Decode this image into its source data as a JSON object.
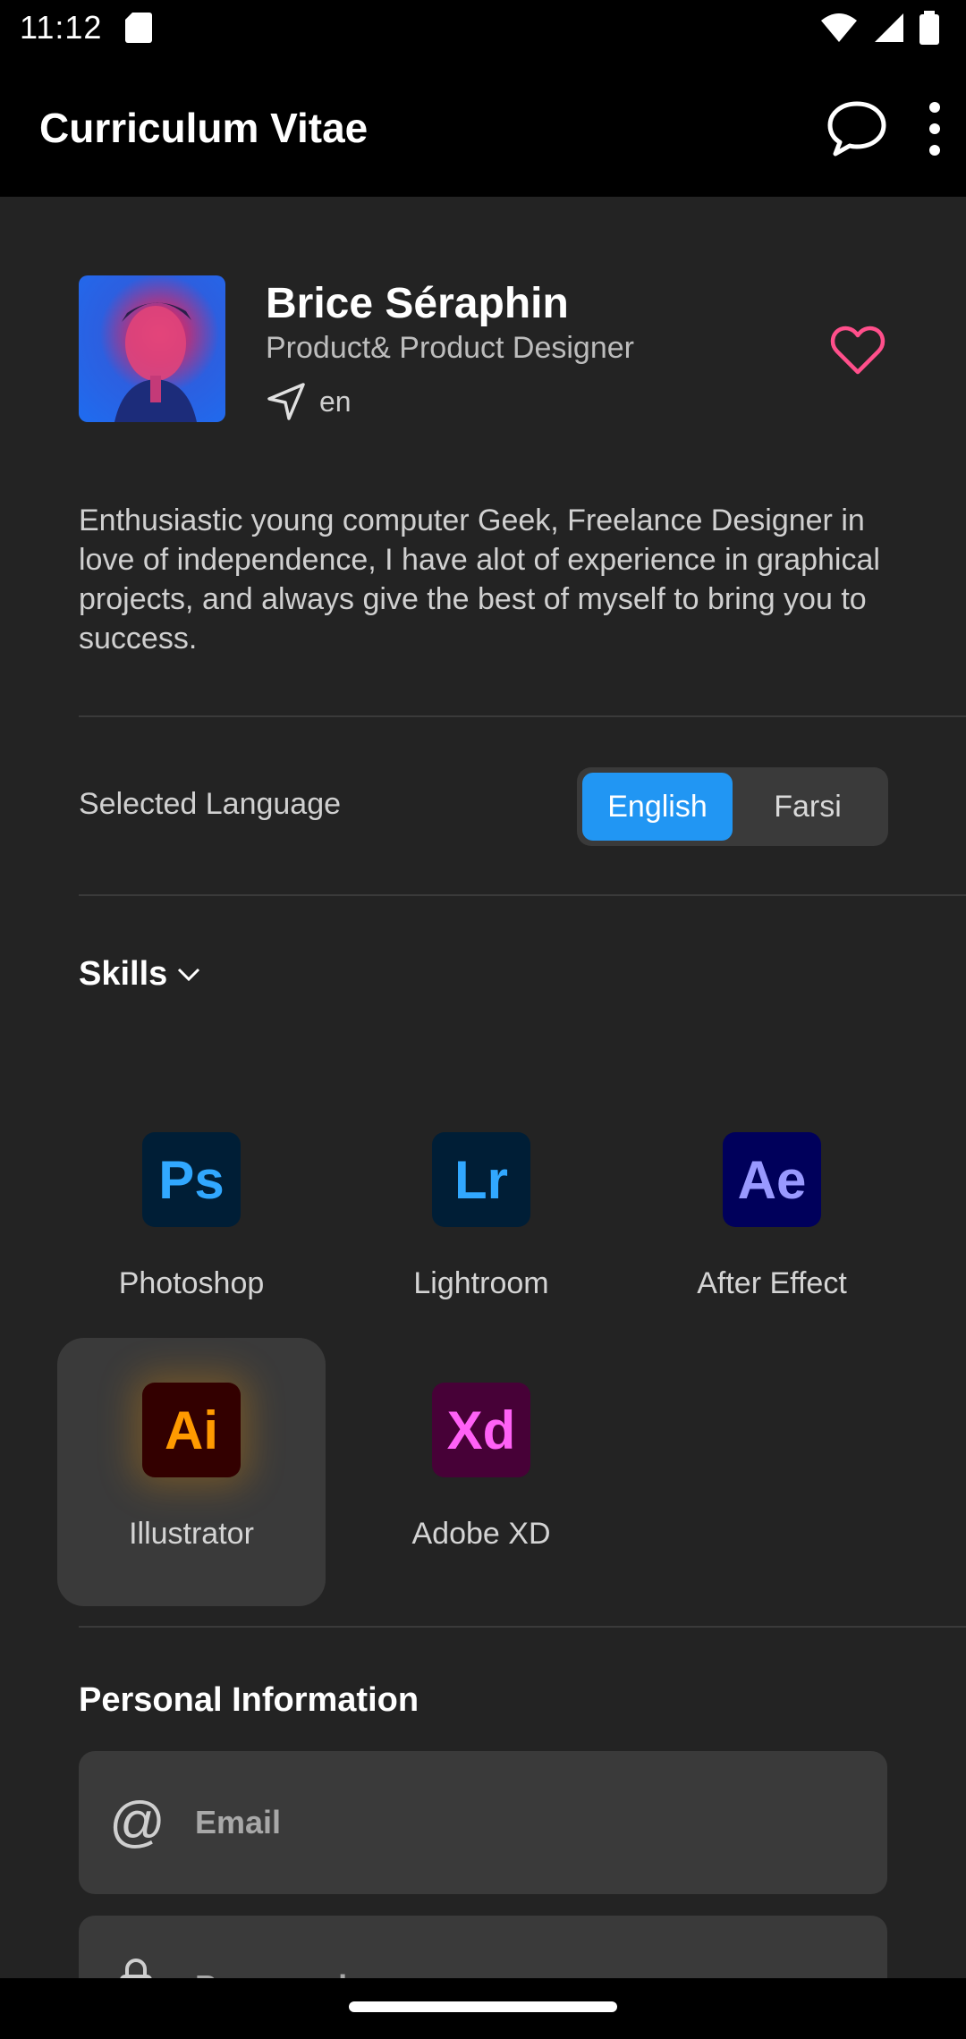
{
  "status_bar": {
    "time": "11:12"
  },
  "app_bar": {
    "title": "Curriculum Vitae"
  },
  "profile": {
    "name": "Brice Séraphin",
    "role": "Product& Product Designer",
    "location": "en"
  },
  "bio": "Enthusiastic young computer Geek, Freelance Designer in love of independence, I have alot of experience in graphical projects, and always give the best of myself to bring you to success.",
  "language": {
    "label": "Selected Language",
    "options": [
      "English",
      "Farsi"
    ],
    "selected": "English"
  },
  "skills": {
    "title": "Skills",
    "items": [
      {
        "abbr": "Ps",
        "name": "Photoshop",
        "bg": "#001e36",
        "fg": "#31a8ff"
      },
      {
        "abbr": "Lr",
        "name": "Lightroom",
        "bg": "#001e36",
        "fg": "#31a8ff"
      },
      {
        "abbr": "Ae",
        "name": "After Effect",
        "bg": "#00005b",
        "fg": "#9999ff"
      },
      {
        "abbr": "Ai",
        "name": "Illustrator",
        "bg": "#330000",
        "fg": "#ff9a00"
      },
      {
        "abbr": "Xd",
        "name": "Adobe XD",
        "bg": "#470137",
        "fg": "#ff61f6"
      }
    ],
    "selected": "Illustrator"
  },
  "personal_info": {
    "title": "Personal Information",
    "email_placeholder": "Email",
    "password_placeholder": "Password"
  },
  "colors": {
    "accent": "#2196f3",
    "heart": "#ff4f8b",
    "background": "#232323",
    "appbar": "#000000"
  }
}
